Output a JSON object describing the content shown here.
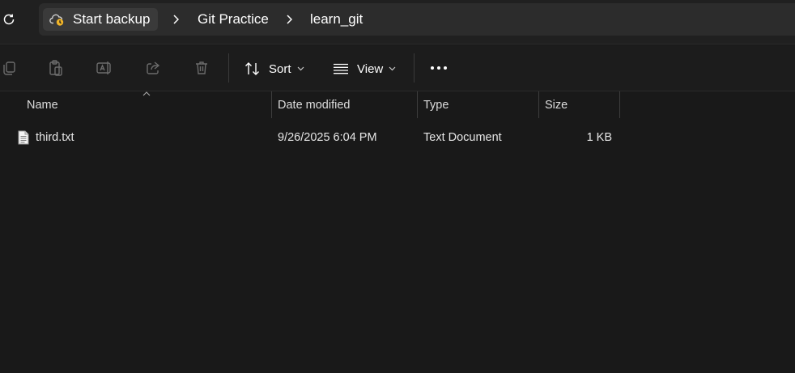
{
  "address_bar": {
    "breadcrumbs": [
      {
        "label": "Start backup",
        "icon": "cloud-backup-icon"
      },
      {
        "label": "Git Practice"
      },
      {
        "label": "learn_git"
      }
    ],
    "separator_icon": "chevron-right-icon",
    "refresh_icon": "refresh-icon"
  },
  "toolbar": {
    "icons": [
      "copy-icon",
      "paste-icon",
      "rename-icon",
      "share-icon",
      "delete-icon"
    ],
    "sort_label": "Sort",
    "view_label": "View",
    "more_icon": "more-icon"
  },
  "columns": {
    "name": "Name",
    "date_modified": "Date modified",
    "type": "Type",
    "size": "Size"
  },
  "files": [
    {
      "name": "third.txt",
      "date_modified": "9/26/2025 6:04 PM",
      "type": "Text Document",
      "size": "1 KB",
      "icon": "text-file-icon"
    }
  ],
  "colors": {
    "background": "#191919",
    "address_bar": "#2c2c2c",
    "text": "#ffffff",
    "backup_accent": "#f0b429"
  }
}
